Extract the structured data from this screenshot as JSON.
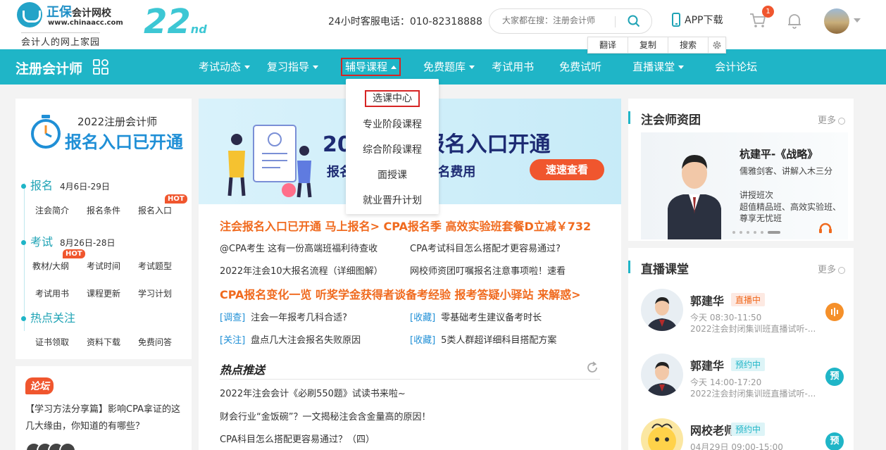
{
  "header": {
    "brand": "正保",
    "brand_small": "会计网校",
    "url": "www.chinaacc.com",
    "slogan": "会计人的网上家园",
    "campaign_num": "22",
    "campaign_suffix": "nd",
    "hotline": "24小时客服电话：010-82318888",
    "search_placeholder": "大家都在搜：注册会计师",
    "app_download": "APP下载",
    "cart_count": "1"
  },
  "toolbar": {
    "translate": "翻译",
    "copy": "复制",
    "search": "搜索"
  },
  "nav": {
    "brand": "注册会计师",
    "items": [
      {
        "label": "考试动态",
        "caret": true
      },
      {
        "label": "复习指导",
        "caret": true
      },
      {
        "label": "辅导课程",
        "caret": true,
        "active": true
      },
      {
        "label": "免费题库",
        "caret": true
      },
      {
        "label": "考试用书",
        "caret": false
      },
      {
        "label": "免费试听",
        "caret": false
      },
      {
        "label": "直播课堂",
        "caret": true
      },
      {
        "label": "会计论坛",
        "caret": false
      }
    ],
    "dropdown": [
      "选课中心",
      "专业阶段课程",
      "综合阶段课程",
      "面授课",
      "就业晋升计划"
    ]
  },
  "left": {
    "reg_year": "2022注册会计师",
    "reg_title": "报名入口已开通",
    "sections": [
      {
        "title": "报名",
        "date": "4月6日-29日",
        "chips": [
          "注会简介",
          "报名条件",
          "报名入口"
        ]
      },
      {
        "title": "考试",
        "date": "8月26日-28日",
        "chips": [
          "教材/大纲",
          "考试时间",
          "考试题型",
          "考试用书",
          "课程更新",
          "学习计划"
        ]
      },
      {
        "title": "热点关注",
        "date": "",
        "chips": [
          "证书领取",
          "资料下载",
          "免费问答"
        ]
      }
    ],
    "hot_label": "HOT",
    "forum_tag": "论坛",
    "forum_text": "【学习方法分享篇】影响CPA拿证的这几大缘由，你知道的有哪些？"
  },
  "middle": {
    "banner_title": "2022注会报名入口开通",
    "banner_sub": "报名流程&课程&报名费用",
    "banner_btn": "速速查看",
    "headline1": "注会报名入口已开通 马上报名>   CPA报名季 高效实验班套餐D立减￥732",
    "rows1": [
      [
        "@CPA考生 这有一份高端班福利待查收",
        "CPA考试科目怎么搭配才更容易通过?"
      ],
      [
        "2022年注会10大报名流程（详细图解）",
        "网校师资团叮嘱报名注意事项啦！速看"
      ]
    ],
    "headline2": "CPA报名变化一览   听奖学金获得者谈备考经验   报考答疑小驿站 来解惑>",
    "rows2": [
      [
        {
          "tag": "[调查]",
          "text": "注会一年报考几科合适?"
        },
        {
          "tag": "[收藏]",
          "text": "零基础考生建议备考时长"
        }
      ],
      [
        {
          "tag": "[关注]",
          "text": "盘点几大注会报名失败原因"
        },
        {
          "tag": "[收藏]",
          "text": "5类人群超详细科目搭配方案"
        }
      ]
    ],
    "hot_title": "热点推送",
    "hot_list": [
      "2022年注会会计《必刷550题》试读书来啦~",
      "财会行业“金饭碗”？一文揭秘注会含金量高的原因！",
      "CPA科目怎么搭配更容易通过？（四）"
    ]
  },
  "right": {
    "teachers_title": "注会师资团",
    "more": "更多",
    "teacher": {
      "name": "杭建平-《战略》",
      "desc": "儒雅剑客、讲解入木三分",
      "class_label": "讲授班次",
      "classes": "超值精品班、高效实验班、尊享无忧班"
    },
    "live_title": "直播课堂",
    "lives": [
      {
        "name": "郭建华",
        "status": "直播中",
        "time": "今天 08:30-11:50",
        "title": "2022注会封闭集训班直播试听-...",
        "btn": "",
        "state": "on"
      },
      {
        "name": "郭建华",
        "status": "预约中",
        "time": "今天 14:00-17:20",
        "title": "2022注会封闭集训班直播试听-...",
        "btn": "预",
        "state": "pre"
      },
      {
        "name": "网校老师",
        "status": "预约中",
        "time": "04月29日 09:00-15:00",
        "title": "",
        "btn": "预",
        "state": "pre"
      }
    ]
  },
  "colors": {
    "teal": "#1fb5c7",
    "orange": "#f06a1e",
    "blue": "#1f8fd6",
    "red_border": "#d62424"
  }
}
